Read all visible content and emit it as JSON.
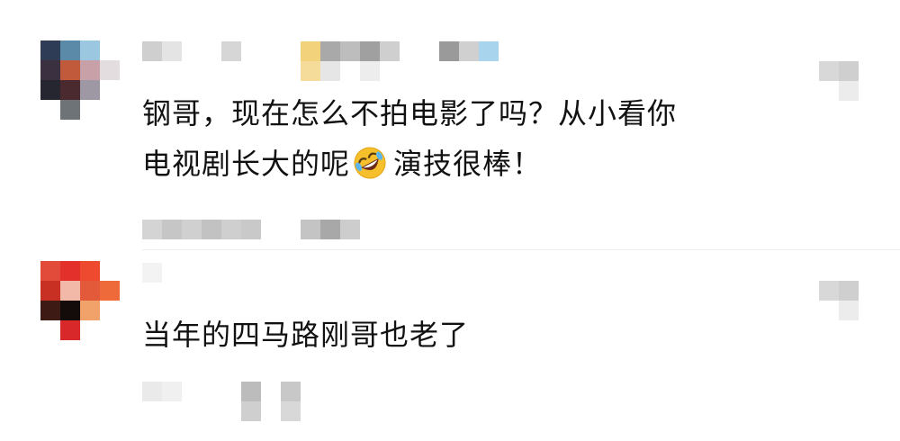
{
  "comments": [
    {
      "text_line1": "钢哥，现在怎么不拍电影了吗？从小看你",
      "text_line2_before": "电视剧长大的呢",
      "emoji": "rolling-on-floor-laughing-emoji",
      "text_line2_after": "演技很棒！",
      "username": "",
      "meta": "",
      "like_count": ""
    },
    {
      "text": "当年的四马路刚哥也老了",
      "username": "",
      "meta": "",
      "like_count": ""
    }
  ],
  "colors": {
    "text": "#111111",
    "background": "#ffffff",
    "mosaic_gray": "#c8c8c8",
    "emoji_face": "#f5c02c"
  }
}
